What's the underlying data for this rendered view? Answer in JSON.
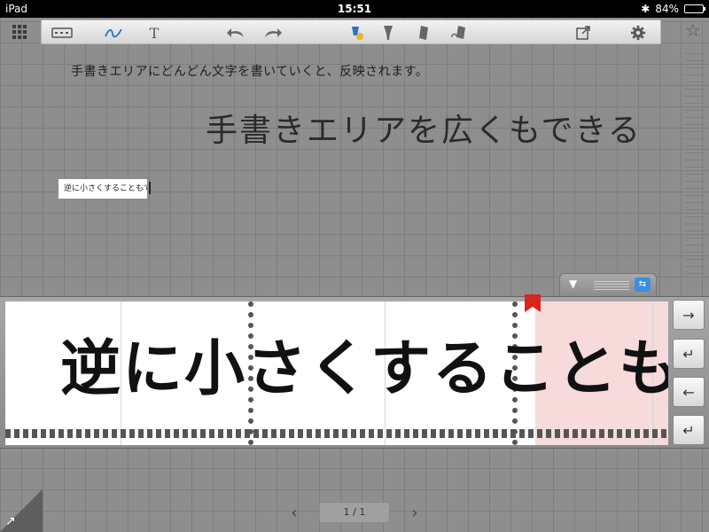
{
  "statusbar": {
    "device": "iPad",
    "time": "15:51",
    "battery": "84%",
    "battery_level": 0.84
  },
  "toolbar": {
    "text_tool": "T",
    "undo_icon": "undo-icon",
    "redo_icon": "redo-icon"
  },
  "canvas": {
    "small_note": "手書きエリアにどんどん文字を書いていくと、反映されます。",
    "large_note": "手書きエリアを広くもできる",
    "boxed_note": "逆に小さくすることもできる"
  },
  "writing_area": {
    "text": "逆に小さくすることもできる",
    "highlight_color": "#f7dada",
    "bookmark_color": "#d9251c"
  },
  "side_buttons": [
    "→",
    "↵",
    "←",
    "↵"
  ],
  "pager": {
    "prev": "‹",
    "next": "›",
    "page": "1 / 1"
  }
}
